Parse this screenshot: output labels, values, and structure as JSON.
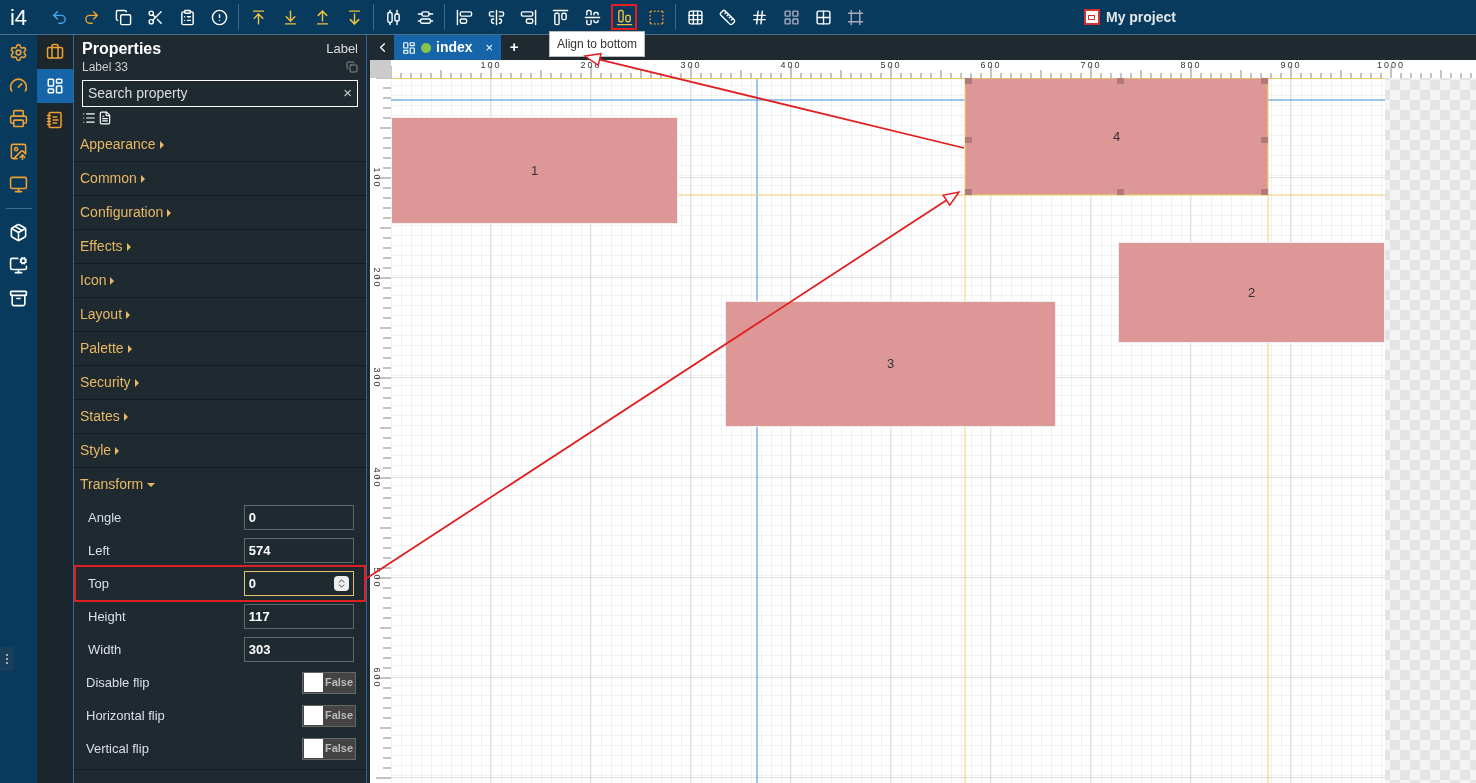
{
  "app": {
    "logo": "i4",
    "project_title": "My project"
  },
  "toolbar": {
    "groups": [
      [
        {
          "highlighted": false
        },
        {
          "highlighted": false
        },
        {
          "highlighted": false
        },
        {
          "highlighted": false
        },
        {
          "highlighted": false
        },
        {
          "highlighted": false
        }
      ],
      [
        {
          "highlighted": false
        },
        {
          "highlighted": false
        },
        {
          "highlighted": false
        },
        {
          "highlighted": false
        }
      ],
      [
        {
          "highlighted": false
        },
        {
          "highlighted": false
        }
      ],
      [
        {
          "highlighted": false
        },
        {
          "highlighted": false
        },
        {
          "highlighted": false
        },
        {
          "highlighted": false
        },
        {
          "highlighted": false
        },
        {
          "highlighted": true
        },
        {
          "highlighted": false
        }
      ],
      [
        {
          "highlighted": false
        },
        {
          "highlighted": false
        },
        {
          "highlighted": false
        },
        {
          "highlighted": false
        },
        {
          "highlighted": false
        },
        {
          "highlighted": false
        }
      ]
    ]
  },
  "tooltip": "Align to bottom",
  "side_tabs": [
    {
      "selected": false
    },
    {
      "selected": true
    },
    {
      "selected": false
    }
  ],
  "properties": {
    "title": "Properties",
    "subtitle": "Label 33",
    "type": "Label",
    "search": {
      "placeholder": "Search property"
    },
    "clear": "×",
    "sections": [
      {
        "label": "Appearance",
        "expanded": false
      },
      {
        "label": "Common",
        "expanded": false
      },
      {
        "label": "Configuration",
        "expanded": false
      },
      {
        "label": "Effects",
        "expanded": false
      },
      {
        "label": "Icon",
        "expanded": false
      },
      {
        "label": "Layout",
        "expanded": false
      },
      {
        "label": "Palette",
        "expanded": false
      },
      {
        "label": "Security",
        "expanded": false
      },
      {
        "label": "States",
        "expanded": false
      },
      {
        "label": "Style",
        "expanded": false
      },
      {
        "label": "Transform",
        "expanded": true,
        "fields": [
          {
            "kind": "number",
            "label": "Angle",
            "value": "0",
            "focused": false,
            "annotated": false
          },
          {
            "kind": "number",
            "label": "Left",
            "value": "574",
            "focused": false,
            "annotated": false
          },
          {
            "kind": "number",
            "label": "Top",
            "value": "0",
            "focused": true,
            "annotated": true
          },
          {
            "kind": "number",
            "label": "Height",
            "value": "117",
            "focused": false,
            "annotated": false
          },
          {
            "kind": "number",
            "label": "Width",
            "value": "303",
            "focused": false,
            "annotated": false
          },
          {
            "kind": "toggle",
            "label": "Disable flip",
            "on": false,
            "text": "False"
          },
          {
            "kind": "toggle",
            "label": "Horizontal flip",
            "on": false,
            "text": "False"
          },
          {
            "kind": "toggle",
            "label": "Vertical flip",
            "on": false,
            "text": "False"
          }
        ]
      }
    ]
  },
  "editor": {
    "tabs": [
      {
        "label": "index",
        "selected": true,
        "color": "#8bc34a",
        "close": "×"
      }
    ],
    "add": "+",
    "ruler": {
      "x_labels": [
        "100",
        "200",
        "300",
        "400",
        "500",
        "600",
        "700",
        "800",
        "900",
        "1000"
      ],
      "y_labels": [
        "100",
        "200",
        "300",
        "400",
        "500",
        "600"
      ]
    },
    "elements": [
      {
        "label": "1",
        "selected": false
      },
      {
        "label": "4",
        "selected": true
      },
      {
        "label": "2",
        "selected": false
      },
      {
        "label": "3",
        "selected": false
      }
    ]
  }
}
